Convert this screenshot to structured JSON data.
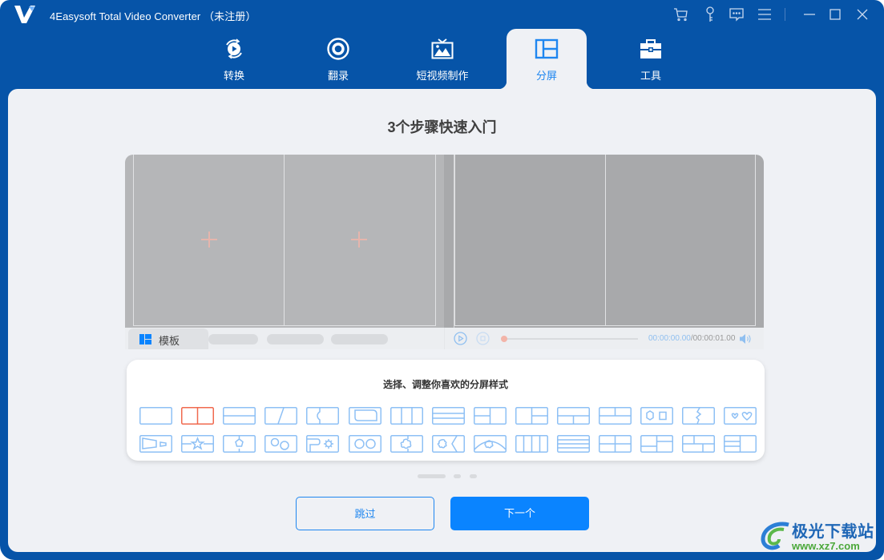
{
  "window": {
    "title": "4Easysoft Total Video Converter （未注册）",
    "controls": [
      "cart-icon",
      "key-icon",
      "feedback-icon",
      "menu-icon",
      "minimize-icon",
      "maximize-icon",
      "close-icon"
    ]
  },
  "nav": {
    "tabs": [
      {
        "label": "转换",
        "icon": "convert-icon",
        "active": false
      },
      {
        "label": "翻录",
        "icon": "disc-icon",
        "active": false
      },
      {
        "label": "短视频制作",
        "icon": "tv-image-icon",
        "active": false
      },
      {
        "label": "分屏",
        "icon": "split-screen-icon",
        "active": true
      },
      {
        "label": "工具",
        "icon": "toolbox-icon",
        "active": false
      }
    ]
  },
  "main": {
    "heading": "3个步骤快速入门",
    "preview": {
      "template_tab_label": "模板",
      "time_current": "00:00:00.00",
      "time_total": "/00:00:01.00"
    },
    "style_picker": {
      "title": "选择、调整你喜欢的分屏样式",
      "selected_index": 1,
      "row1": [
        "single",
        "two-vertical",
        "two-horizontal",
        "diagonal",
        "puzzle-edge",
        "rounded-inset",
        "three-vertical",
        "three-horizontal",
        "left-split-right-full",
        "left-full-right-split",
        "top-full-bottom-split",
        "top-split-bottom-full",
        "hexagon-square",
        "jagged-split",
        "heart-pair"
      ],
      "row2": [
        "trapezoid-pair",
        "star-band",
        "pentagon-split",
        "gear-circles",
        "rounded-sunburst",
        "two-circles",
        "cross-puzzle",
        "cross-chevron",
        "arc-cross",
        "four-vertical",
        "four-horizontal",
        "quad-grid",
        "left-top-split-grid",
        "top-split-bottom-split",
        "left-three-right-full"
      ]
    },
    "pager": {
      "pages": 3,
      "current": 1
    },
    "buttons": {
      "skip": "跳过",
      "next": "下一个"
    }
  },
  "watermark": {
    "name": "极光下载站",
    "url": "www.xz7.com"
  },
  "colors": {
    "brand_blue": "#0654a8",
    "accent": "#0a84ff",
    "selected": "#f06a4f",
    "tile_stroke": "#8ec0f5"
  }
}
